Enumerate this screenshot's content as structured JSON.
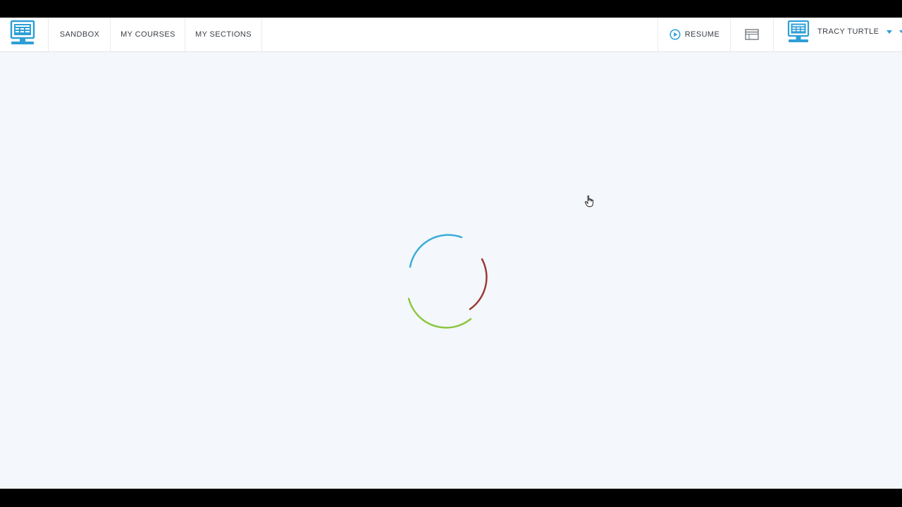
{
  "nav": {
    "sandbox": "SANDBOX",
    "my_courses": "MY COURSES",
    "my_sections": "MY SECTIONS"
  },
  "header_actions": {
    "resume": "RESUME",
    "user_name": "TRACY TURTLE"
  },
  "icons": {
    "logo": "computer-monitor-icon",
    "resume": "play-circle-icon",
    "window": "browser-window-icon",
    "avatar": "computer-monitor-icon",
    "dropdown": "caret-down-icon",
    "cursor": "hand-pointer-icon"
  },
  "colors": {
    "accent_blue": "#2e9fd6",
    "spinner_blue": "#3aaed8",
    "spinner_red": "#9b3b34",
    "spinner_green": "#8cc63f",
    "background": "#f4f7fb"
  }
}
